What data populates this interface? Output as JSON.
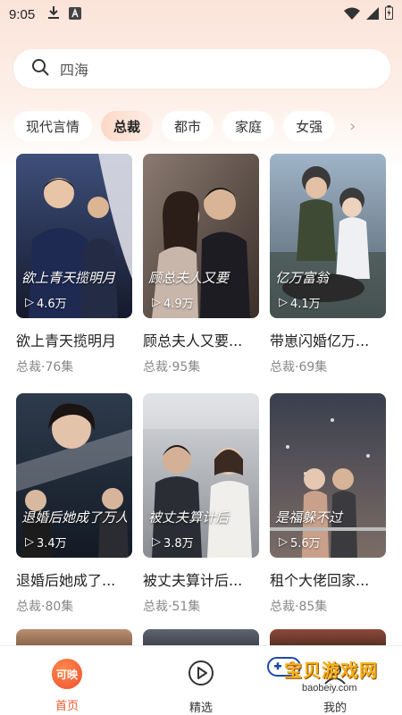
{
  "status_bar": {
    "time": "9:05",
    "icons": [
      "download-icon",
      "a-box-icon",
      "wifi-icon",
      "signal-icon",
      "battery-icon"
    ]
  },
  "search": {
    "text": "四海",
    "icon": "search-icon"
  },
  "category_chips": {
    "items": [
      "现代言情",
      "总裁",
      "都市",
      "家庭",
      "女强"
    ],
    "active_index": 1,
    "more_icon": "chevron-right-icon"
  },
  "dramas": [
    {
      "poster_title": "欲上青天揽明月",
      "plays": "4.6万",
      "title": "欲上青天揽明月",
      "meta": "总裁·76集"
    },
    {
      "poster_title": "顾总夫人又要",
      "plays": "4.9万",
      "title": "顾总夫人又要...",
      "meta": "总裁·95集"
    },
    {
      "poster_title": "亿万富翁",
      "plays": "4.1万",
      "title": "带崽闪婚亿万...",
      "meta": "总裁·69集"
    },
    {
      "poster_title": "退婚后她成了万人迷",
      "plays": "3.4万",
      "title": "退婚后她成了...",
      "meta": "总裁·80集"
    },
    {
      "poster_title": "被丈夫算计后",
      "plays": "3.8万",
      "title": "被丈夫算计后...",
      "meta": "总裁·51集"
    },
    {
      "poster_title": "是福躲不过",
      "plays": "5.6万",
      "title": "租个大佬回家...",
      "meta": "总裁·85集"
    }
  ],
  "tabbar": {
    "home_logo_text": "可映",
    "home_label": "首页",
    "featured_label": "精选",
    "third_label": "我的"
  },
  "watermark": {
    "text": "宝贝游戏网",
    "url": "baobeiy.com"
  },
  "colors": {
    "accent": "#ef5a2b",
    "active_chip": "#fcd8c6",
    "background_top": "#fbe3d9"
  }
}
